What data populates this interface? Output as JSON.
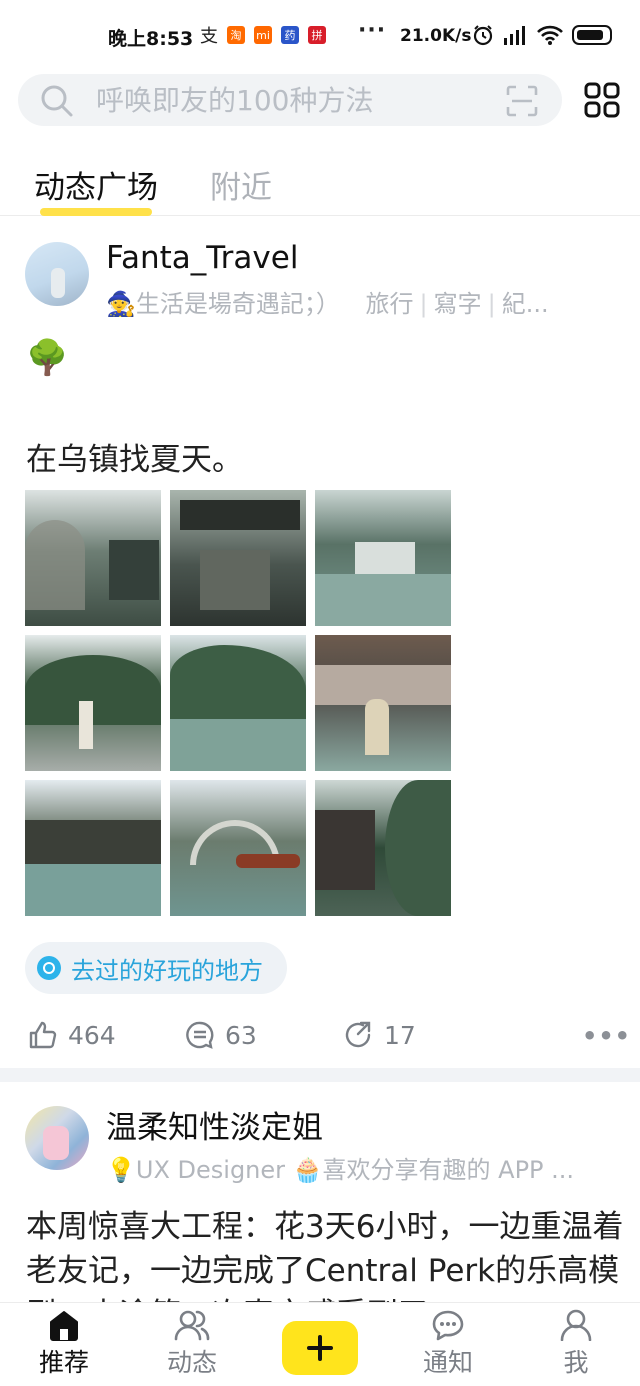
{
  "status_bar": {
    "time": "晚上8:53",
    "app_icons": [
      {
        "glyph": "支",
        "color": "#1677ff"
      },
      {
        "glyph": "淘",
        "color": "#ff6a00"
      },
      {
        "glyph": "mi",
        "color": "#ff6700"
      },
      {
        "glyph": "药",
        "color": "#2a55c9"
      },
      {
        "glyph": "拼",
        "color": "#d81e2a"
      }
    ],
    "dots": "···",
    "network_speed": "21.0K/s"
  },
  "search": {
    "placeholder": "呼唤即友的100种方法"
  },
  "tabs": [
    {
      "label": "动态广场",
      "active": true
    },
    {
      "label": "附近",
      "active": false
    }
  ],
  "posts": [
    {
      "username": "Fanta_Travel",
      "bio": "🧙生活是場奇遇記；）",
      "tags": [
        "旅行",
        "寫字",
        "紀..."
      ],
      "emoji": "🌳",
      "text": "在乌镇找夏天。",
      "photo_count": 9,
      "topic": "去过的好玩的地方",
      "likes": "464",
      "comments": "63",
      "shares": "17"
    },
    {
      "username": "温柔知性淡定姐",
      "bio": "💡UX Designer  🧁喜欢分享有趣的 APP ...",
      "text": "本周惊喜大工程：花3天6小时，一边重温着老友记，一边完成了Central Perk的乐高模型，中途第一次真实感受到了"
    }
  ],
  "bottom_nav": {
    "home": "推荐",
    "feed": "动态",
    "notify": "通知",
    "me": "我"
  },
  "colors": {
    "accent_yellow": "#ffe41c",
    "topic_blue": "#2aa4db",
    "muted_text": "#b2b6bc"
  }
}
